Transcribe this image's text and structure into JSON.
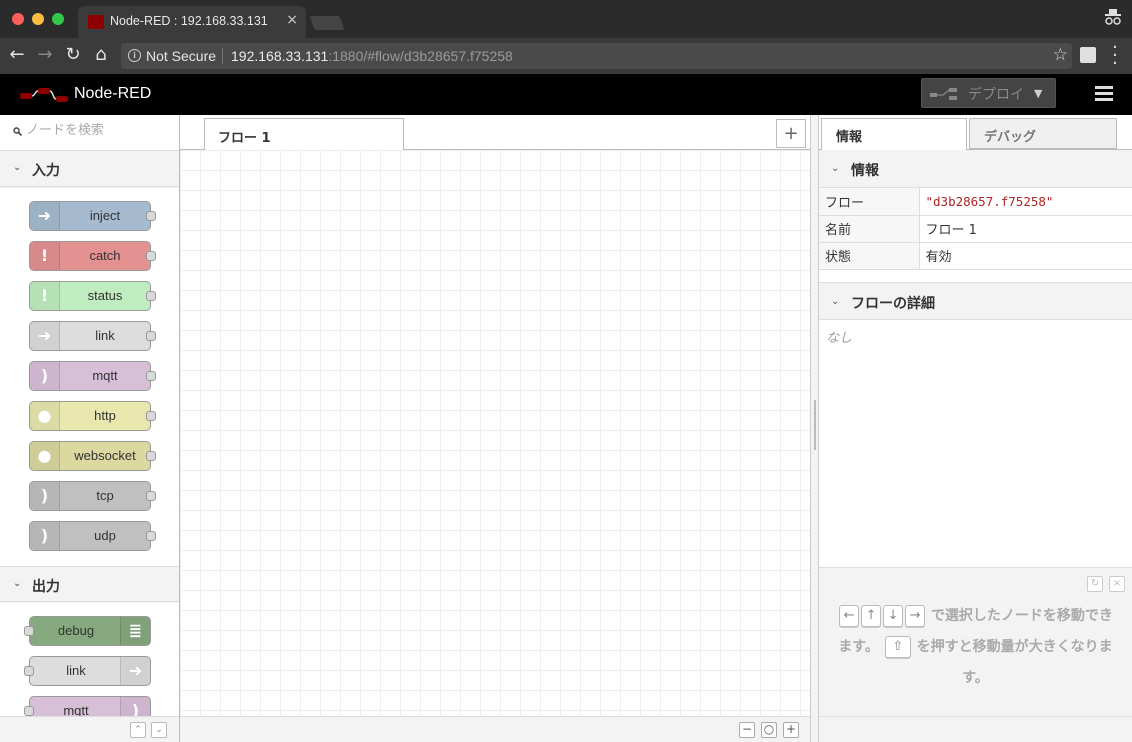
{
  "browser": {
    "tab_title": "Node-RED : 192.168.33.131",
    "tab_close": "×",
    "secure_label": "Not Secure",
    "url_host": "192.168.33.131",
    "url_path": ":1880/#flow/d3b28657.f75258",
    "back": "←",
    "forward": "→",
    "reload": "↻",
    "home": "⌂",
    "star": "☆",
    "menu": "⋮"
  },
  "header": {
    "title": "Node-RED",
    "deploy_label": "デプロイ",
    "deploy_caret": "▼"
  },
  "palette": {
    "search_placeholder": "ノードを検索",
    "categories": [
      {
        "label": "入力",
        "chevron": "⌄"
      },
      {
        "label": "出力",
        "chevron": "⌄"
      }
    ],
    "input_nodes": [
      {
        "label": "inject",
        "color": "#a6bbcf",
        "icon": "arrow-in-icon",
        "glyph": "➜"
      },
      {
        "label": "catch",
        "color": "#e49191",
        "icon": "alert-icon",
        "glyph": "!"
      },
      {
        "label": "status",
        "color": "#c0edc0",
        "icon": "alert-icon",
        "glyph": "!"
      },
      {
        "label": "link",
        "color": "#dddddd",
        "icon": "link-icon",
        "glyph": "➜"
      },
      {
        "label": "mqtt",
        "color": "#d8bfd8",
        "icon": "bridge-icon",
        "glyph": ")"
      },
      {
        "label": "http",
        "color": "#e7e7ae",
        "icon": "globe-icon",
        "glyph": "●"
      },
      {
        "label": "websocket",
        "color": "#dbd8a0",
        "icon": "globe-icon",
        "glyph": "●"
      },
      {
        "label": "tcp",
        "color": "#c0c0c0",
        "icon": "bridge-icon",
        "glyph": ")"
      },
      {
        "label": "udp",
        "color": "#c0c0c0",
        "icon": "bridge-icon",
        "glyph": ")"
      }
    ],
    "output_nodes": [
      {
        "label": "debug",
        "color": "#87a980",
        "icon": "debug-icon",
        "glyph": "≣"
      },
      {
        "label": "link",
        "color": "#dddddd",
        "icon": "link-icon",
        "glyph": "➜"
      },
      {
        "label": "mqtt",
        "color": "#d8bfd8",
        "icon": "bridge-icon",
        "glyph": ")"
      }
    ],
    "footer_up": "⌃",
    "footer_down": "⌄"
  },
  "workspace": {
    "tab_label": "フロー 1",
    "add_tab": "+",
    "zoom_out": "−",
    "zoom_reset": "○",
    "zoom_in": "+"
  },
  "sidebar": {
    "tabs": [
      {
        "label": "情報",
        "active": true
      },
      {
        "label": "デバッグ",
        "active": false
      }
    ],
    "info_section": "情報",
    "info_rows": [
      {
        "key": "フロー",
        "value": "\"d3b28657.f75258\""
      },
      {
        "key": "名前",
        "value": "フロー 1"
      },
      {
        "key": "状態",
        "value": "有効"
      }
    ],
    "details_section": "フローの詳細",
    "details_empty": "なし",
    "tip": {
      "keys": [
        "←",
        "↑",
        "↓",
        "→"
      ],
      "text_1": "で選択したノードを移動できます。",
      "shift_key": "⇧",
      "text_2": "を押すと移動量が大きくなります。",
      "refresh": "↻",
      "close": "×"
    }
  }
}
